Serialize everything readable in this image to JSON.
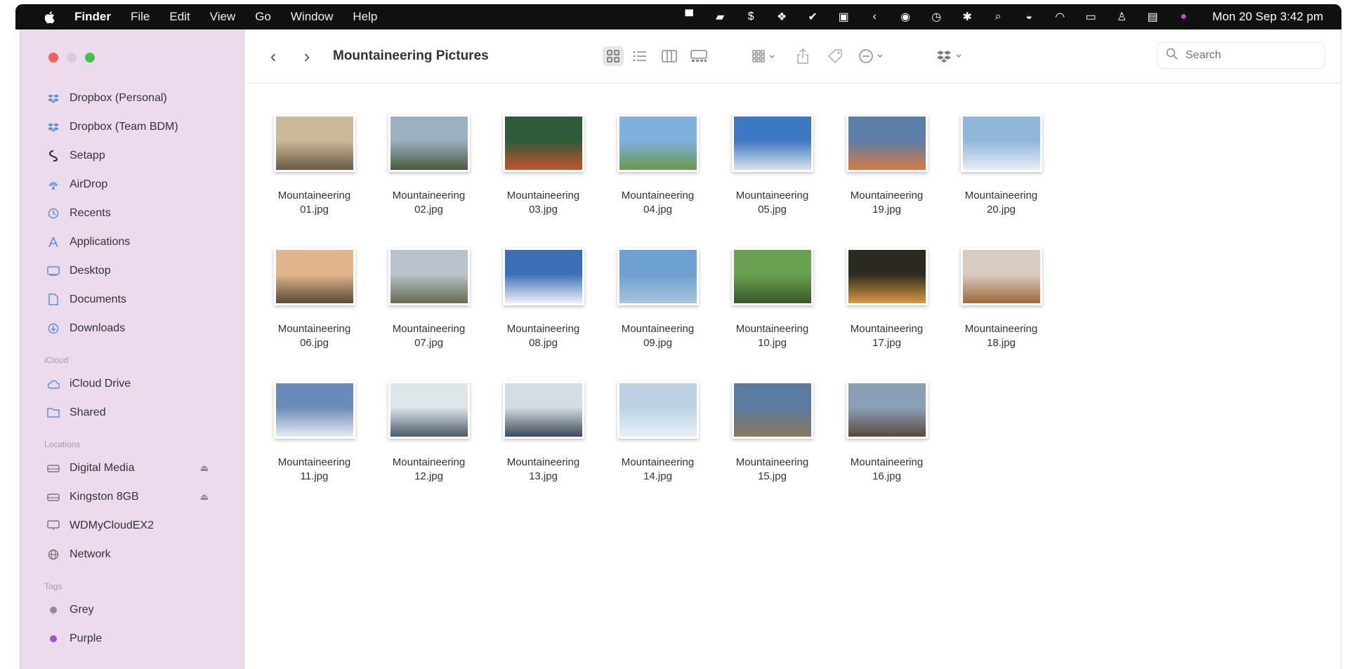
{
  "menubar": {
    "app": "Finder",
    "items": [
      "File",
      "Edit",
      "View",
      "Go",
      "Window",
      "Help"
    ],
    "clock": "Mon 20 Sep  3:42 pm",
    "status_icons": [
      "control-icon",
      "display-icon",
      "setapp-icon",
      "dropbox-icon",
      "check-icon",
      "flag-icon",
      "arrow-icon",
      "screen-icon",
      "timemachine-icon",
      "bluetooth-icon",
      "search-icon",
      "control-center-icon",
      "wifi-icon",
      "keyboard-icon",
      "user-icon",
      "display-mirror-icon",
      "siri-icon"
    ]
  },
  "window": {
    "title": "Mountaineering Pictures",
    "search_placeholder": "Search"
  },
  "sidebar": {
    "favorites": [
      {
        "label": "Dropbox (Personal)",
        "icon": "dropbox-icon"
      },
      {
        "label": "Dropbox (Team BDM)",
        "icon": "dropbox-icon"
      },
      {
        "label": "Setapp",
        "icon": "setapp-icon"
      },
      {
        "label": "AirDrop",
        "icon": "airdrop-icon"
      },
      {
        "label": "Recents",
        "icon": "clock-icon"
      },
      {
        "label": "Applications",
        "icon": "applications-icon"
      },
      {
        "label": "Desktop",
        "icon": "desktop-icon"
      },
      {
        "label": "Documents",
        "icon": "document-icon"
      },
      {
        "label": "Downloads",
        "icon": "download-icon"
      }
    ],
    "icloud_header": "iCloud",
    "icloud": [
      {
        "label": "iCloud Drive",
        "icon": "cloud-icon"
      },
      {
        "label": "Shared",
        "icon": "shared-folder-icon"
      }
    ],
    "locations_header": "Locations",
    "locations": [
      {
        "label": "Digital Media",
        "icon": "drive-icon",
        "eject": true
      },
      {
        "label": "Kingston 8GB",
        "icon": "drive-icon",
        "eject": true
      },
      {
        "label": "WDMyCloudEX2",
        "icon": "display-icon",
        "eject": false
      },
      {
        "label": "Network",
        "icon": "network-icon",
        "eject": false
      }
    ],
    "tags_header": "Tags",
    "tags": [
      {
        "label": "Grey",
        "color": "#8e8e93"
      },
      {
        "label": "Purple",
        "color": "#a550d8"
      }
    ]
  },
  "files": [
    {
      "line1": "Mountaineering",
      "line2": "01.jpg"
    },
    {
      "line1": "Mountaineering",
      "line2": "02.jpg"
    },
    {
      "line1": "Mountaineering",
      "line2": "03.jpg"
    },
    {
      "line1": "Mountaineering",
      "line2": "04.jpg"
    },
    {
      "line1": "Mountaineering",
      "line2": "05.jpg"
    },
    {
      "line1": "Mountaineering",
      "line2": "19.jpg"
    },
    {
      "line1": "Mountaineering",
      "line2": "20.jpg"
    },
    {
      "line1": "Mountaineering",
      "line2": "06.jpg"
    },
    {
      "line1": "Mountaineering",
      "line2": "07.jpg"
    },
    {
      "line1": "Mountaineering",
      "line2": "08.jpg"
    },
    {
      "line1": "Mountaineering",
      "line2": "09.jpg"
    },
    {
      "line1": "Mountaineering",
      "line2": "10.jpg"
    },
    {
      "line1": "Mountaineering",
      "line2": "17.jpg"
    },
    {
      "line1": "Mountaineering",
      "line2": "18.jpg"
    },
    {
      "line1": "Mountaineering",
      "line2": "11.jpg"
    },
    {
      "line1": "Mountaineering",
      "line2": "12.jpg"
    },
    {
      "line1": "Mountaineering",
      "line2": "13.jpg"
    },
    {
      "line1": "Mountaineering",
      "line2": "14.jpg"
    },
    {
      "line1": "Mountaineering",
      "line2": "15.jpg"
    },
    {
      "line1": "Mountaineering",
      "line2": "16.jpg"
    }
  ],
  "thumbnail_palettes": [
    [
      "#c9b89a",
      "#6b5a45"
    ],
    [
      "#9bb0c0",
      "#4a5a40"
    ],
    [
      "#2f5a3a",
      "#c4552a"
    ],
    [
      "#7fb0de",
      "#6a9a4a"
    ],
    [
      "#3f78c2",
      "#d8e2ec"
    ],
    [
      "#5c7ea8",
      "#d87a40"
    ],
    [
      "#8fb7dc",
      "#e8eef4"
    ],
    [
      "#e2b58a",
      "#5a4a3a"
    ],
    [
      "#b8c4cc",
      "#6a6a50"
    ],
    [
      "#3a6fb8",
      "#eef2f6"
    ],
    [
      "#6ca0d0",
      "#a8c4dc"
    ],
    [
      "#6aa050",
      "#3a5a2a"
    ],
    [
      "#2a2a22",
      "#d89a40"
    ],
    [
      "#d8ccc0",
      "#a06a3a"
    ],
    [
      "#6a8ab8",
      "#e8ecf0"
    ],
    [
      "#dfe6ea",
      "#4a5a6a"
    ],
    [
      "#d6dde2",
      "#3a4a5a"
    ],
    [
      "#bcd2e4",
      "#e8f0f6"
    ],
    [
      "#5a7aa0",
      "#8a7a5a"
    ],
    [
      "#8aa0b8",
      "#5a4a3a"
    ]
  ]
}
